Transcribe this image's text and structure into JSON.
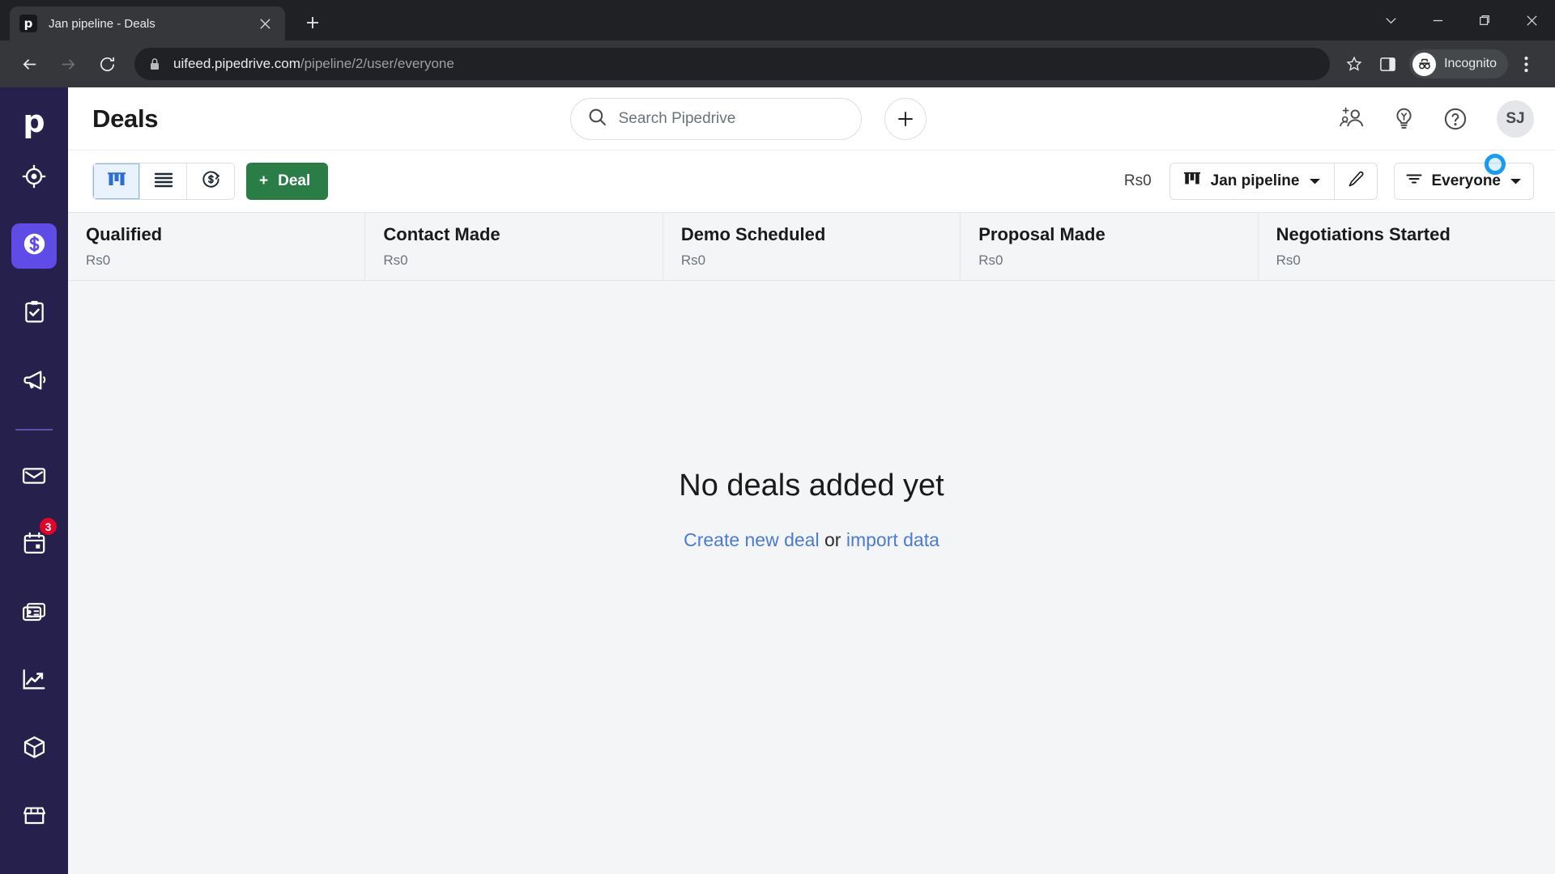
{
  "browser": {
    "tab": {
      "title": "Jan pipeline - Deals",
      "favicon_letter": "p",
      "favicon_name": "pipedrive-favicon",
      "close_icon": "close-icon"
    },
    "new_tab_icon": "plus-icon",
    "window_controls": [
      {
        "name": "tab-search-chevron",
        "glyph": "∨"
      },
      {
        "name": "minimize",
        "glyph": "—"
      },
      {
        "name": "maximize",
        "glyph": "❐"
      },
      {
        "name": "close",
        "glyph": "✕"
      }
    ],
    "nav": {
      "back_icon": "back-arrow-icon",
      "forward_icon": "forward-arrow-icon",
      "reload_icon": "reload-icon"
    },
    "omnibox": {
      "lock_icon": "lock-icon",
      "domain": "uifeed.pipedrive.com",
      "path": "/pipeline/2/user/everyone",
      "bookmark_icon": "star-icon"
    },
    "side_panel_icon": "side-panel-icon",
    "incognito_label": "Incognito",
    "menu_icon": "three-dot-menu-icon"
  },
  "sidebar": {
    "logo": "p",
    "items": [
      {
        "name": "sidebar-item-leads",
        "icon": "target-icon",
        "active": false
      },
      {
        "name": "sidebar-item-deals",
        "icon": "dollar-coin-icon",
        "active": true
      },
      {
        "name": "sidebar-item-activities",
        "icon": "clipboard-check-icon",
        "active": false
      },
      {
        "name": "sidebar-item-campaigns",
        "icon": "megaphone-icon",
        "active": false
      },
      {
        "name": "sidebar-item-mail",
        "icon": "envelope-icon",
        "active": false
      },
      {
        "name": "sidebar-item-calendar",
        "icon": "calendar-icon",
        "active": false,
        "badge": "3"
      },
      {
        "name": "sidebar-item-contacts",
        "icon": "contact-card-icon",
        "active": false
      },
      {
        "name": "sidebar-item-insights",
        "icon": "line-chart-icon",
        "active": false
      },
      {
        "name": "sidebar-item-products",
        "icon": "box-icon",
        "active": false
      },
      {
        "name": "sidebar-item-marketplace",
        "icon": "storefront-icon",
        "active": false
      }
    ],
    "badge_calendar": "3"
  },
  "header": {
    "title": "Deals",
    "search": {
      "placeholder": "Search Pipedrive",
      "icon": "search-icon"
    },
    "add_button_icon": "plus-icon",
    "icons": [
      {
        "name": "invite-user-icon",
        "label": "Invite users"
      },
      {
        "name": "lightbulb-icon",
        "label": "Tips"
      },
      {
        "name": "help-question-icon",
        "label": "Help"
      }
    ],
    "avatar_initials": "SJ"
  },
  "toolbar": {
    "views": [
      {
        "name": "view-pipeline",
        "icon": "kanban-icon",
        "active": true
      },
      {
        "name": "view-list",
        "icon": "list-icon",
        "active": false
      },
      {
        "name": "view-forecast",
        "icon": "forecast-dollar-icon",
        "active": false
      }
    ],
    "deal_button": {
      "label": "Deal",
      "plus": "+"
    },
    "total_amount": "Rs0",
    "pipeline_selector": {
      "label": "Jan pipeline",
      "icon": "kanban-icon",
      "chevron": "chevron-down-icon"
    },
    "edit_pipeline_icon": "pencil-icon",
    "filter": {
      "label": "Everyone",
      "icon": "filter-icon",
      "chevron": "chevron-down-icon"
    },
    "cursor_indicator": "click-ring-indicator"
  },
  "board": {
    "stages": [
      {
        "name": "Qualified",
        "sum": "Rs0"
      },
      {
        "name": "Contact Made",
        "sum": "Rs0"
      },
      {
        "name": "Demo Scheduled",
        "sum": "Rs0"
      },
      {
        "name": "Proposal Made",
        "sum": "Rs0"
      },
      {
        "name": "Negotiations Started",
        "sum": "Rs0"
      }
    ],
    "empty_state": {
      "title": "No deals added yet",
      "link_create": "Create new deal",
      "conjunction": " or ",
      "link_import": "import data"
    }
  },
  "colors": {
    "sidebar_bg": "#26204d",
    "sidebar_active": "#5f4ce6",
    "deal_green": "#2a7d46",
    "link_blue": "#4b7bd6",
    "badge_red": "#e4042b",
    "board_bg": "#f4f5f7",
    "cursor_blue": "#1a9bf0"
  }
}
